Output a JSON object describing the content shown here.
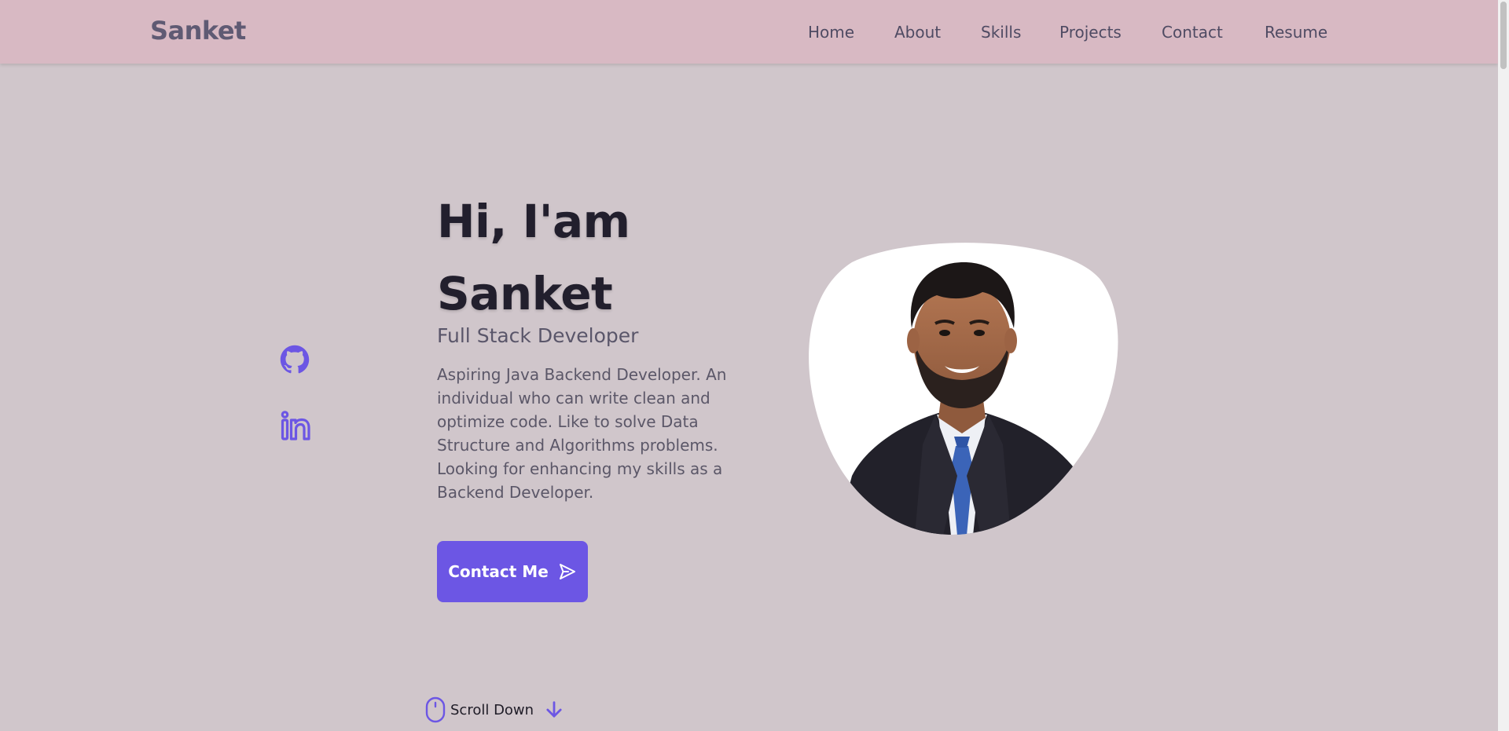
{
  "header": {
    "brand": "Sanket",
    "nav": [
      "Home",
      "About",
      "Skills",
      "Projects",
      "Contact",
      "Resume"
    ]
  },
  "social": {
    "github_icon": "github-icon",
    "linkedin_icon": "linkedin-icon"
  },
  "hero": {
    "greeting": "Hi, I'am",
    "name": "Sanket",
    "subtitle": "Full Stack Developer",
    "description": "Aspiring Java Backend Developer. An individual who can write clean and optimize code. Like to solve Data Structure and Algorithms problems. Looking for enhancing my skills as a Backend Developer.",
    "button_label": "Contact Me",
    "button_icon": "send-icon"
  },
  "scroll": {
    "label": "Scroll Down",
    "mouse_icon": "mouse-icon",
    "arrow_icon": "arrow-down-icon"
  },
  "colors": {
    "page_bg": "#d0c6cb",
    "header_bg": "#d8b9c3",
    "accent": "#6c56e4",
    "heading": "#221f2d",
    "body_text": "#5b5768"
  }
}
